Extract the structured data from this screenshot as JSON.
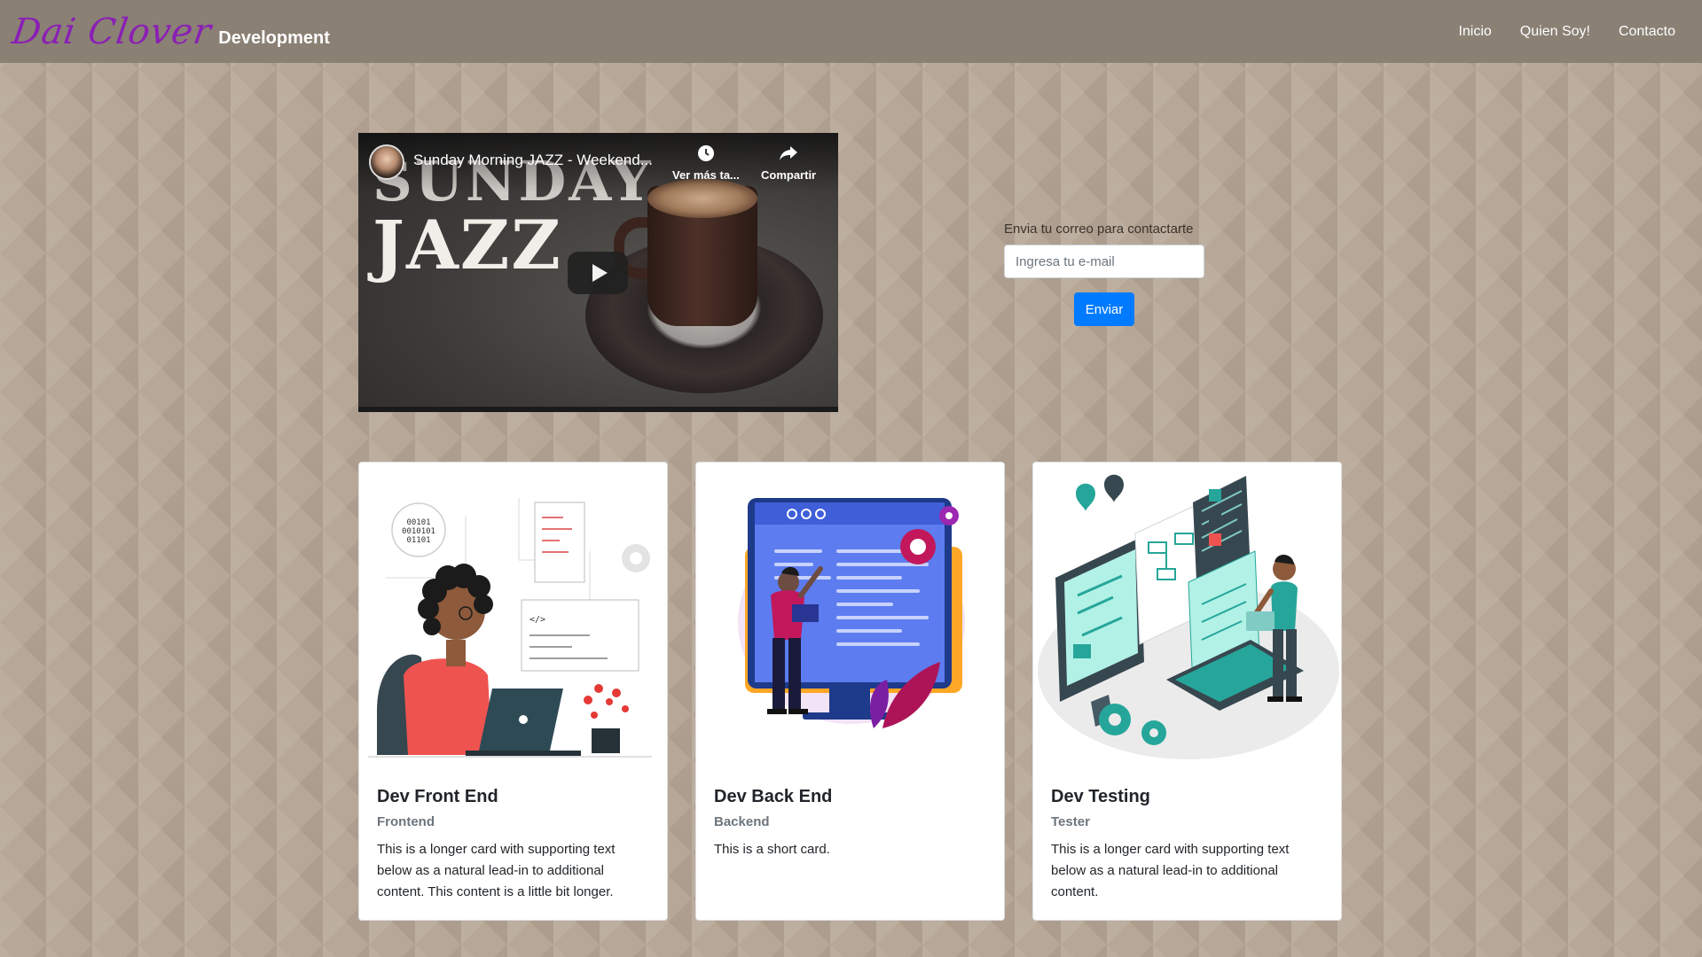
{
  "navbar": {
    "brand_script": "Dai Clover",
    "brand_text": "Development",
    "links": [
      {
        "label": "Inicio"
      },
      {
        "label": "Quien Soy!"
      },
      {
        "label": "Contacto"
      }
    ]
  },
  "video": {
    "overlay_text_1": "SUNDAY",
    "overlay_text_2": "JAZZ",
    "title": "Sunday Morning JAZZ - Weekend...",
    "watch_later": "Ver más ta...",
    "share": "Compartir",
    "icons": {
      "watch_later": "clock-icon",
      "share": "share-arrow-icon",
      "play": "play-icon"
    }
  },
  "contact": {
    "label": "Envia tu correo para contactarte",
    "email_placeholder": "Ingresa tu e-mail",
    "email_value": "",
    "submit_label": "Enviar",
    "accent_color": "#007bff"
  },
  "cards": [
    {
      "title": "Dev Front End",
      "subtitle": "Frontend",
      "text": "This is a longer card with supporting text below as a natural lead-in to additional content. This content is a little bit longer.",
      "illustration": "developer-with-laptop-illustration"
    },
    {
      "title": "Dev Back End",
      "subtitle": "Backend",
      "text": "This is a short card.",
      "illustration": "developer-at-monitor-illustration"
    },
    {
      "title": "Dev Testing",
      "subtitle": "Tester",
      "text": "This is a longer card with supporting text below as a natural lead-in to additional content.",
      "illustration": "tester-with-screens-illustration"
    }
  ],
  "illustration_code": {
    "binary": [
      "00101",
      "0010101",
      "01101"
    ],
    "tag": "</>"
  }
}
